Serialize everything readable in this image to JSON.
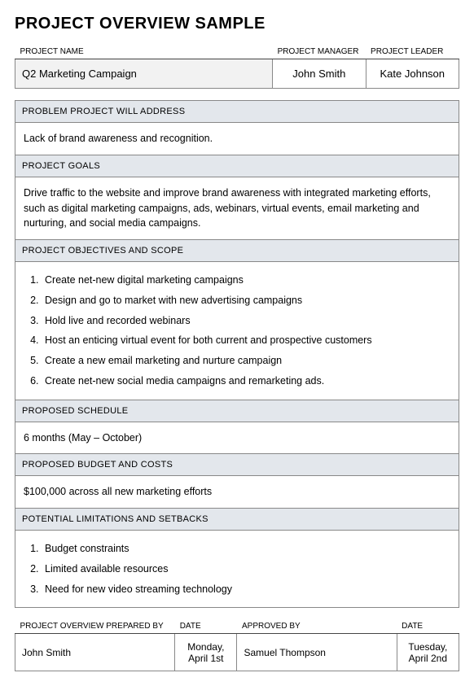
{
  "title": "PROJECT OVERVIEW SAMPLE",
  "header": {
    "labels": {
      "name": "PROJECT NAME",
      "manager": "PROJECT MANAGER",
      "leader": "PROJECT LEADER"
    },
    "values": {
      "name": "Q2 Marketing Campaign",
      "manager": "John Smith",
      "leader": "Kate Johnson"
    }
  },
  "sections": {
    "problem": {
      "label": "PROBLEM PROJECT WILL ADDRESS",
      "body": "Lack of brand awareness and recognition."
    },
    "goals": {
      "label": "PROJECT GOALS",
      "body": "Drive traffic to the website and improve brand awareness with integrated marketing efforts, such as digital marketing campaigns, ads, webinars, virtual events, email marketing and nurturing, and social media campaigns."
    },
    "objectives": {
      "label": "PROJECT OBJECTIVES AND SCOPE",
      "items": [
        "Create net-new digital marketing campaigns",
        "Design and go to market with new advertising campaigns",
        "Hold live and recorded webinars",
        "Host an enticing virtual event for both current and prospective customers",
        "Create a new email marketing and nurture campaign",
        "Create net-new social media campaigns and remarketing ads."
      ]
    },
    "schedule": {
      "label": "PROPOSED SCHEDULE",
      "body": "6 months (May – October)"
    },
    "budget": {
      "label": "PROPOSED BUDGET AND COSTS",
      "body": "$100,000 across all new marketing efforts"
    },
    "limitations": {
      "label": "POTENTIAL LIMITATIONS AND SETBACKS",
      "items": [
        "Budget constraints",
        "Limited available resources",
        "Need for new video streaming technology"
      ]
    }
  },
  "footer": {
    "labels": {
      "prepared_by": "PROJECT OVERVIEW PREPARED BY",
      "date1": "DATE",
      "approved_by": "APPROVED BY",
      "date2": "DATE"
    },
    "values": {
      "prepared_by": "John Smith",
      "date1": "Monday, April 1st",
      "approved_by": "Samuel Thompson",
      "date2": "Tuesday, April 2nd"
    }
  }
}
